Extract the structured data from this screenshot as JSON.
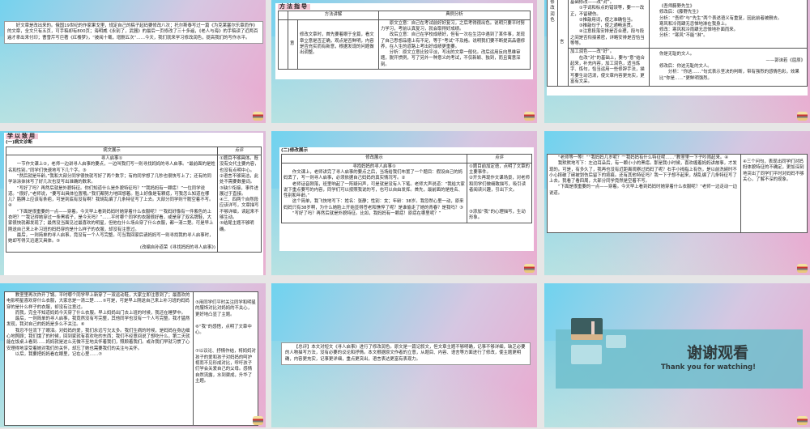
{
  "s1": {
    "intro": "好文章是改出来的。俄国19世纪的作家果戈里，规定自己的稿子起码要修改八次；托尔斯泰写过一篇《为克莱塞尔乐章而作》的文章，全文只有五页，可手稿却有800页；海明威《永别了，武器》的最后一页修改了三十多遍，《老人与海》的手稿读了近两百遍才拿出来付印；曹雪芹写巨著《红楼梦》，“披阅十载，增删五次”……今天，我们就来学习修改润色，提高我们的写作水平。"
  },
  "s2": {
    "heading": "方法指导",
    "col1": "方法讲解",
    "col2": "典例分析",
    "row_label": "意",
    "method": "修改文章时，首先要着眼于全篇，看文章立意是否正确，观点是否鲜明，内容是否充实而有新意，根据发现的问题做出调整。",
    "ex": [
      "原文立意：自己在考试前好好复习，之后考得很出色。说明只要平时努力学习，考前认真复习，就会取得好成绩。",
      "改后立意：自己在学校成绩好，但有一次在生活中遇到了某件事，发现了自己思想品德上有不足，等于“考试”不及格。说明我们要不断提高品德修养，在人生的道路上考出好成绩更重要。",
      "分析：原文立意比较平淡，写出的文章一般化。改后运用反向思维审题，脱开惯例，写了另外一种意义的考试，不仅新颖、独到，而且寓意深刻。"
    ]
  },
  "s3": {
    "side": "修改润色",
    "row_label": "言",
    "m1": [
      "基础修改——改“对”。",
      "①字词和标点的错误等，要一一改正，不留硬伤。",
      "②推敲用词，使之准确恰当。",
      "③推敲句子，使之通畅连贯。",
      "④注意段落安排是否合理，段与段之间是否衔接紧密，详略安排是否恰当等等。"
    ],
    "e1": [
      "《吾师藤野先生》",
      "修改后：《藤野先生》",
      "分析：“吾师”与“先生”两个表述语义有重复，因此前者被删去。",
      "寒风和冷雨肆无忌惮地淋在我身上。",
      "修改：寒风和冷雨肆无忌惮地扑面而来。",
      "分析：“寒风”不能“淋”。"
    ],
    "m2": [
      "加工润色——改“好”。",
      "在改“对”的基础上，要与“意”结合起来，补充内容，加工润色，适当炼字、炼句，恰当运用一些修辞手法，描写要生动活泼，使文章内容更充实，更富有文采。"
    ],
    "e2": [
      "你是无耻的文人。",
      "——郭沫若《屈原》",
      "修改后：你这无耻的文人。",
      "分析：“你这……”句式表示坚决的判断，带有强烈的感情色彩，效果比“你是……”更鲜明强烈。"
    ]
  },
  "s4": {
    "heading": "学以致用",
    "sub": "(一)病文诊断",
    "col1": "病文展示",
    "col2": "点评",
    "title": "寻人启事①",
    "paras": [
      "一节作文课上②，老师一边讲寻人启事的要点，一边叫我们写一则寻找妈妈的寻人启事。“最前面的是姓名和性别。”同学们快速地写下几个字。③",
      "“然后就是年龄。”我和大部分同学很快就写好了两个数字；有的同学想了几秒也很快写上了；还有的同学涂涂抹抹写了好几次也没写出准确的数来。",
      "“写好了吗？再然后就是外貌特征。你们知道什么是外貌特征吗？”“我妈妈有一颗痣！”一位同学说道。“很好，”老师说，“要写出具体位置哦。”我们都努力地回想着。脸上好像是有颗痣，可我怎么知道在哪儿？胳膊上应该有条疤，可是到底有没有啊？我胡乱编了几条特征写了上去。大部分同学则干脆空着不写。④",
      "“下面是很重要的一点——穿着。今天早上看到妈妈时她穿着什么衣服呢？”“我妈好像有一件紫色的上衣吧？”“我记得她穿过一条黑裤子，是今天吗？”……平时哪个同学的衣服很好看，或是穿了双名牌鞋，大家很快就都发现了；最然没当面见过最喜欢的明星，但他在什么场合穿了什么衣服，都一清二楚。可是早上刚送自己来上补习班的妈妈穿的是什么样子的衣服，却没有注意过。",
      "最后，一则简单的寻人启事，竟没有一个人写完整。可当我回家后请妈妈写一则寻找我的寻人启事时，她却写得又迅速又具体。⑤"
    ],
    "source": "(改编自孙道荣《寻找妈妈的寻人启事》)",
    "comments": [
      "①题目不够具体。既没有交代主要内容，也没有点明中心。",
      "②语言不够简洁，此处不需要数量词。",
      "③缺少衔接，事件进展过于直接。",
      "④三、四两个自然段应该详写，文章描写不够详细，读起来不够生动。",
      "⑤结尾主题不够明确。"
    ]
  },
  "s5": {
    "sub": "(二)修改展示",
    "col1": "修改展示",
    "col2": "点评",
    "title": "寻找妈妈的寻人启事①",
    "paras": [
      "作文课上，老师讲完了寻人启事的要点之后，当场给我们布置了一个题目：假设自己的妈妈丢了，写一则寻人启事，必须依据自己妈妈的真实情况写。②",
      "老师话音刚落，班里响起了一阵疑问声，可是就是没有人下笔。老师大声说道：“我给大家说下重点要写的内容，同学们可以按照我说的写，也可以自由发挥。首先，最前面的是姓名、性别和年龄。”",
      "这个简单，我飞快地写下：姓名：张静；性别：女；年龄：38岁。我忽然心里一动，原来妈妈只有38岁啊，为什么她脸上开始显得苍老和憔悴了呢？是谁偷走了她的青春？是我吗？③",
      "“写好了吗？再然后就是外貌特征。比如，我妈妈有一颗痣！原痣在哪里呢？”"
    ],
    "comments": [
      "①题目前加定语，点明了文章的主要事件。",
      "②开头再现作文课场景，对老师和同学们做细致描写，吸引读者阅读兴趣，引出下文。",
      "③添加“我”的心理描写，生动形象。"
    ]
  },
  "s6": {
    "paras": [
      "“老师等一等！”“我妈妈几岁呢？”“我妈妈有什么特征呢……”教室里一下子吵闹起来。④",
      "我默默地写下：左边耳朵后，有一颗小小的黑痣。那是我小时候，喜欢缠着妈妈讲故事，才发现的。可是，有多久了，我再也没有近距离观察过妈妈了呢？右手小拇指上有伤，是以前洗碗时不小心摔破了碗被划伤后留下的疤痕。还有其他特征吗？我一下子想不起来，胡乱编了几条特征写了上去。我看了看四周，大部分同学竟然是空着不写。",
      "“下面是很重要的一点——穿着。今天早上看到妈妈时她穿着什么衣服呢？”老师一边走动一边说道。"
    ],
    "comment": "④三个问句，表现出同学们对妈妈体貌特征的不确定，更加深刻地突出了同学们平时对妈妈不够关心，了解不深的现象。"
  },
  "s7": {
    "paras": [
      "教室里再次炸开了锅。平时哪个同学早上新穿了一双运动鞋，大家立即注意到了；最喜欢的电影明星喜欢穿什么衣服，大家总是一清二楚……⑤可是，可是早上刚送自己来上补习班的妈妈穿的是什么样子的衣服，却没有注意过。",
      "而我，完全不知道妈妈今天穿了什么衣服。早上妈妈出门去上班的时候，我还在睡梦中。",
      "最后，一则简单的寻人启事，我竟然没有写完整，其他同学也没有一个人写完整。我才猛然发现，我对自己的妈妈是多么不关注。⑥",
      "我忍不住流下了眼泪。对妈妈的爱，我们永远亏欠太多。我们生病的时候，是妈妈在身边细心地照顾；我们饿了的时候，回到家就有喜欢吃的东西；我们不经意间说了想吃什么，第二天就能在饭桌上看到……妈妈就是这么无微不至地关怀着我们，照顾着我们。或许我们早就习惯了心安理得地享受着她对我们的关怀，却忘了她也需要我们的关注与关怀。",
      "以后，我要把妈妈看在眼里，记在心里……⑦"
    ],
    "comments": [
      "⑤用同学们平时关注同学和明星的服饰对比对妈妈的不关心，更好地凸显了主题。",
      "⑥“我”的感悟，点明了文章中心。",
      "⑦以议论、抒情作结，将妈妈对孩子的爱和孩子对妈妈的呵护视而不见形成对比，呼吁孩子们学会关爱自己的父母。感情自然流露，水到渠成，升华了主题。"
    ]
  },
  "s8": {
    "summary": "【总评】本文对短文《寻人启事》进行了修改润色。原文是一篇记叙文，但文章主题不够明确，记事不够详细，缺乏必要的人物描写方法，没有必要的议论和抒情。本文根据原文作者的立意，从题目、内容、语言等方面进行了修改，使主题更明确，内容更充实，记事更详细，重点更突出，语言表达更富有表现力。"
  },
  "s9": {
    "title": "谢谢观看",
    "subtitle": "Thank you for watching!"
  }
}
